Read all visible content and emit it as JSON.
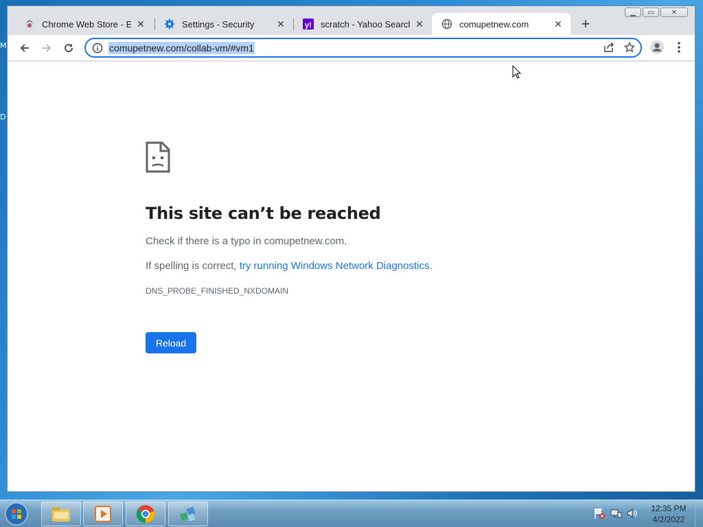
{
  "desktop": {
    "edge_letters": [
      "M",
      "D"
    ]
  },
  "browser": {
    "tabs": [
      {
        "title": "Chrome Web Store - Exte",
        "favicon": "chrome-web-store-icon"
      },
      {
        "title": "Settings - Security",
        "favicon": "settings-gear-icon"
      },
      {
        "title": "scratch - Yahoo Search Re",
        "favicon": "yahoo-icon"
      },
      {
        "title": "comupetnew.com",
        "favicon": "globe-icon",
        "active": true
      }
    ],
    "new_tab_label": "+",
    "close_glyph": "✕",
    "address": {
      "url": "comupetnew.com/collab-vm/#vm1"
    }
  },
  "error_page": {
    "heading": "This site can’t be reached",
    "typo_text": "Check if there is a typo in comupetnew.com.",
    "spelling_prefix": "If spelling is correct, ",
    "diagnostics_link": "try running Windows Network Diagnostics",
    "spelling_suffix": ".",
    "error_code": "DNS_PROBE_FINISHED_NXDOMAIN",
    "reload_label": "Reload"
  },
  "taskbar": {
    "pinned": [
      "windows-explorer-icon",
      "media-player-icon",
      "chrome-icon",
      "network-app-icon"
    ],
    "clock": {
      "time": "12:35 PM",
      "date": "4/2/2022"
    }
  },
  "colors": {
    "accent": "#1a73e8",
    "link": "#1a73e8",
    "text_secondary": "#5f6368"
  }
}
